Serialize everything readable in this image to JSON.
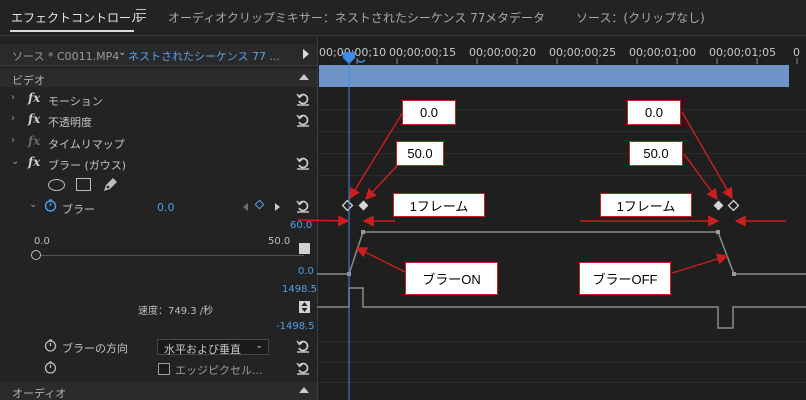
{
  "tabs": {
    "effect_controls": "エフェクトコントロール",
    "audio_mixer": "オーディオクリップミキサー：ネストされたシーケンス 77",
    "metadata": "メタデータ",
    "source": "ソース：(クリップなし)"
  },
  "source_bar": {
    "source_clip": "ソース * C0011.MP4",
    "sequence_clip": "ネストされたシーケンス 77 ..."
  },
  "sections": {
    "video": "ビデオ",
    "audio": "オーディオ"
  },
  "effects": [
    {
      "label": "モーション"
    },
    {
      "label": "不透明度"
    },
    {
      "label": "タイムリマップ"
    },
    {
      "label": "ブラー (ガウス)"
    }
  ],
  "blur_param": {
    "label": "ブラー",
    "value": "0.0",
    "range_min": "0.0",
    "range_max": "50.0",
    "graph_top": "60.0",
    "graph_bottom": "0.0",
    "velocity_top": "1498.5",
    "velocity_bottom": "-1498.5",
    "velocity_label": "速度：749.3 /秒"
  },
  "direction": {
    "label": "ブラーの方向",
    "value": "水平および垂直"
  },
  "edge_pixels": {
    "label": "エッジピクセル..."
  },
  "ruler": {
    "ticks": [
      "00;00;00;10",
      "00;00;00;15",
      "00;00;00;20",
      "00;00;00;25",
      "00;00;01;00",
      "00;00;01;05",
      "0"
    ]
  },
  "annotations": {
    "val_a1": "0.0",
    "val_a2": "50.0",
    "val_b1": "0.0",
    "val_b2": "50.0",
    "frame_a": "1フレーム",
    "frame_b": "1フレーム",
    "blur_on": "ブラーON",
    "blur_off": "ブラーOFF"
  },
  "colors": {
    "accent_blue": "#4f9fe8",
    "clip_bar": "#6f95c8",
    "annotation_red": "#cc1f1f"
  }
}
